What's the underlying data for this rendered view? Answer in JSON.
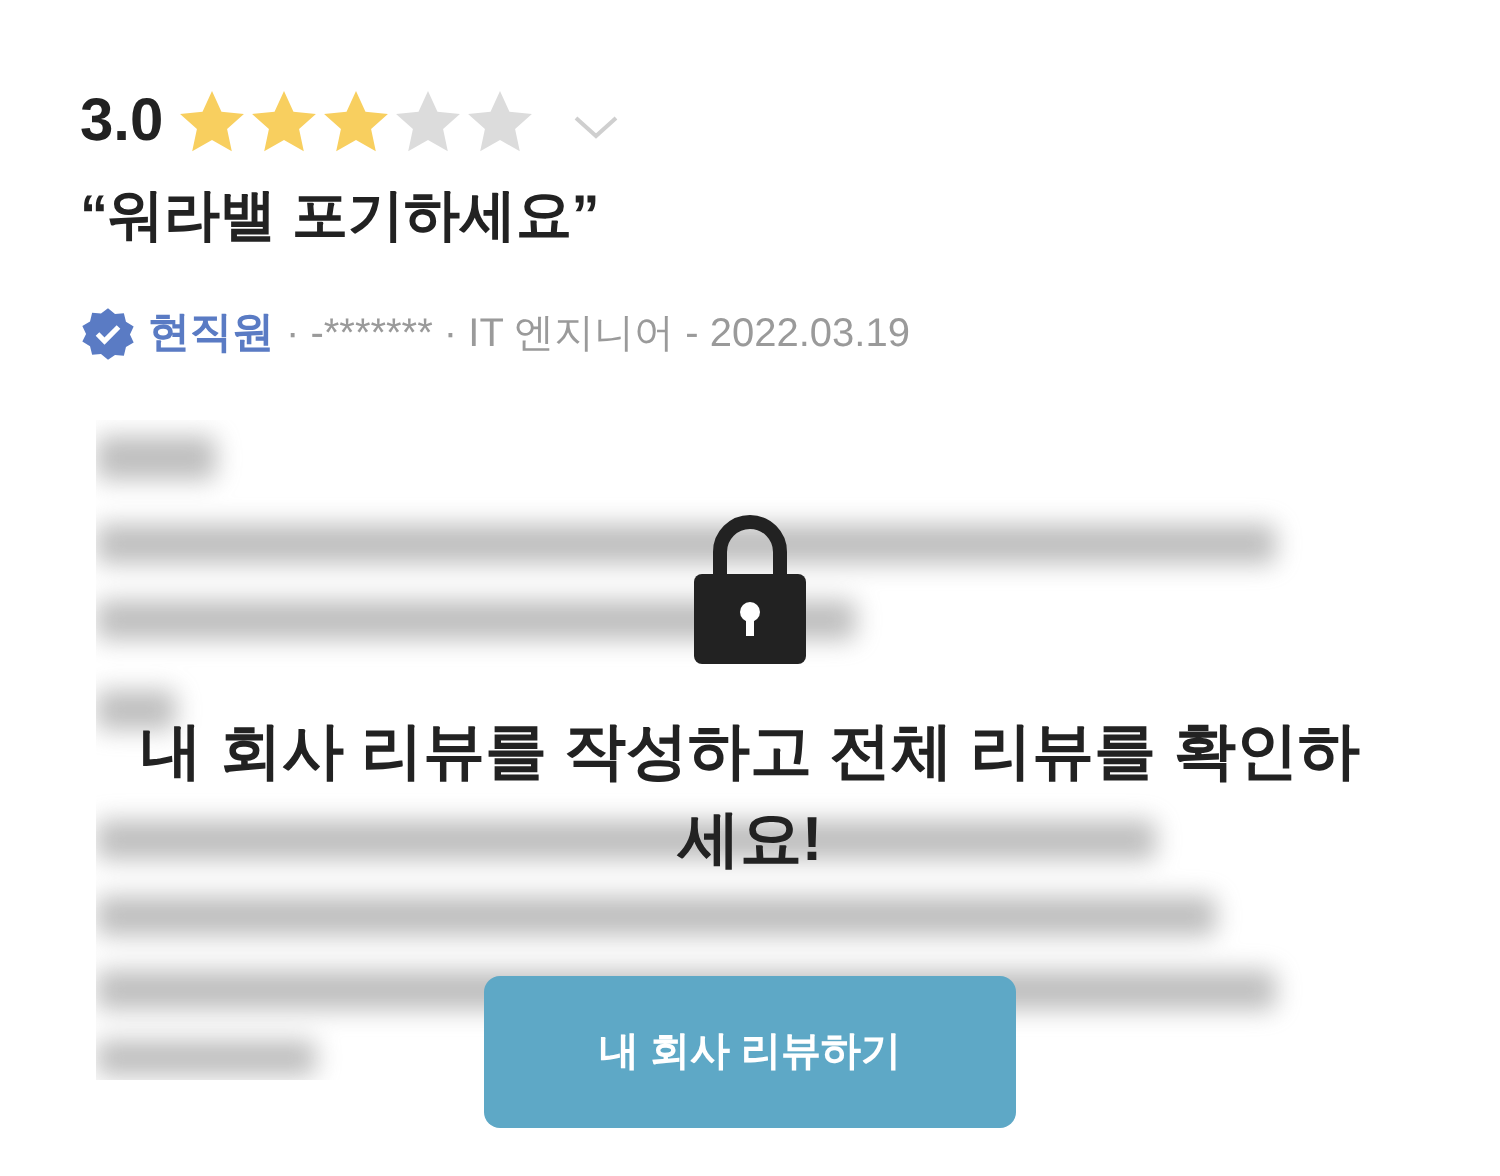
{
  "review": {
    "score": "3.0",
    "stars": 3,
    "title": "“워라밸 포기하세요”",
    "badge": "현직원",
    "meta": "· -******* · IT 엔지니어 - 2022.03.19"
  },
  "lock_overlay": {
    "message": "내 회사 리뷰를 작성하고 전체 리뷰를 확인하세요!",
    "button": "내 회사 리뷰하기"
  }
}
